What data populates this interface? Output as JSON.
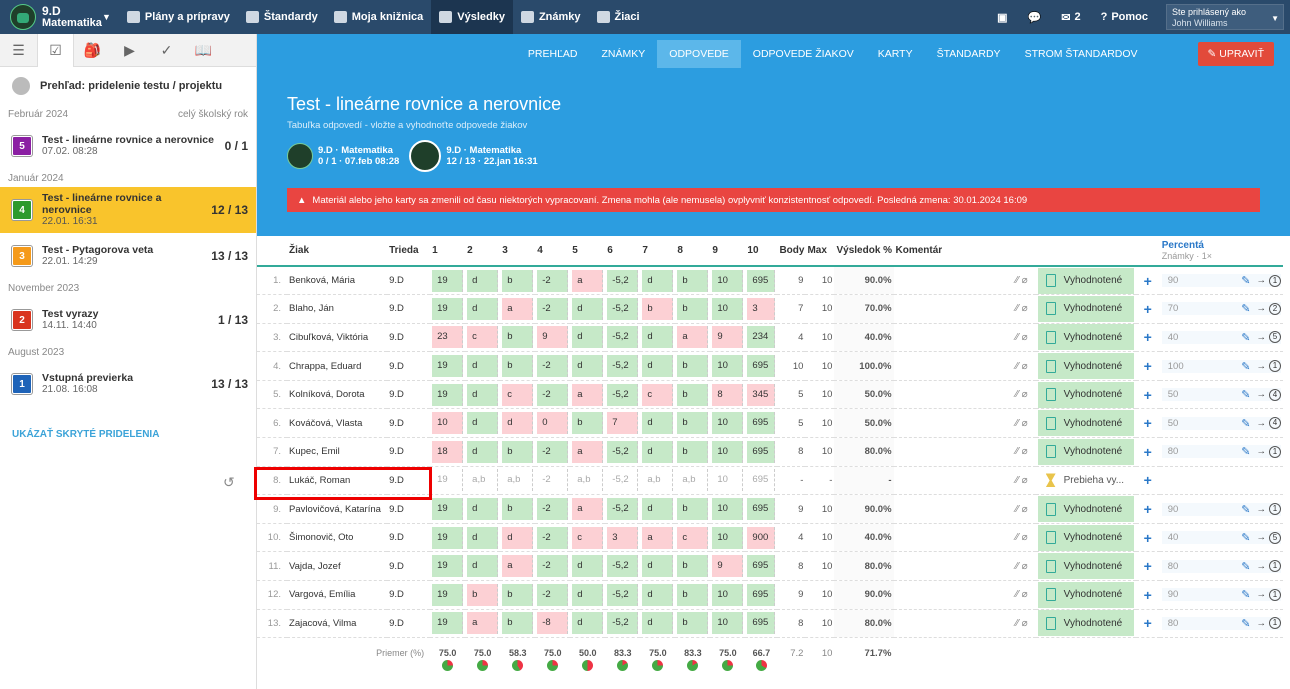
{
  "topbar": {
    "class_line1": "9.D",
    "class_line2": "Matematika",
    "nav": [
      "Plány a prípravy",
      "Štandardy",
      "Moja knižnica",
      "Výsledky",
      "Známky",
      "Žiaci"
    ],
    "active_nav": 3,
    "messages_count": "2",
    "help": "Pomoc",
    "user_label": "Ste prihlásený ako",
    "user_name": "John Williams"
  },
  "sidebar": {
    "overview": "Prehľad: pridelenie testu / projektu",
    "sections": [
      {
        "label": "Február 2024",
        "filter": "celý školský rok",
        "items": [
          {
            "badge": "5",
            "color": "#8b1fa3",
            "title": "Test - lineárne rovnice a nerovnice",
            "date": "07.02. 08:28",
            "score": "0 / 1"
          }
        ]
      },
      {
        "label": "Január 2024",
        "items": [
          {
            "badge": "4",
            "color": "#2d9a2d",
            "title": "Test - lineárne rovnice a nerovnice",
            "date": "22.01. 16:31",
            "score": "12 / 13",
            "selected": true
          },
          {
            "badge": "3",
            "color": "#f59a1a",
            "title": "Test - Pytagorova veta",
            "date": "22.01. 14:29",
            "score": "13 / 13"
          }
        ]
      },
      {
        "label": "November 2023",
        "items": [
          {
            "badge": "2",
            "color": "#d9341e",
            "title": "Test vyrazy",
            "date": "14.11. 14:40",
            "score": "1 / 13"
          }
        ]
      },
      {
        "label": "August 2023",
        "items": [
          {
            "badge": "1",
            "color": "#1e63b8",
            "title": "Vstupná previerka",
            "date": "21.08. 16:08",
            "score": "13 / 13"
          }
        ]
      }
    ],
    "show_hidden": "UKÁZAŤ SKRYTÉ PRIDELENIA"
  },
  "subnav": {
    "tabs": [
      "PREHĽAD",
      "ZNÁMKY",
      "ODPOVEDE",
      "ODPOVEDE ŽIAKOV",
      "KARTY",
      "ŠTANDARDY",
      "STROM ŠTANDARDOV"
    ],
    "active": 2,
    "edit": "UPRAVIŤ"
  },
  "hero": {
    "title": "Test - lineárne rovnice a nerovnice",
    "subtitle": "Tabuľka odpovedí - vložte a vyhodnoťte odpovede žiakov",
    "groups": [
      {
        "name": "9.D · Matematika",
        "info": "0 / 1 · 07.feb 08:28"
      },
      {
        "name": "9.D · Matematika",
        "info": "12 / 13 · 22.jan 16:31"
      }
    ],
    "alert": "Materiál alebo jeho karty sa zmenili od času niektorých vypracovaní. Zmena mohla (ale nemusela) ovplyvniť konzistentnosť odpovedí. Posledná zmena: 30.01.2024 16:09"
  },
  "table": {
    "headers": {
      "student": "Žiak",
      "class": "Trieda",
      "q": [
        "1",
        "2",
        "3",
        "4",
        "5",
        "6",
        "7",
        "8",
        "9",
        "10"
      ],
      "points": "Body",
      "max": "Max",
      "result": "Výsledok %",
      "comment": "Komentár",
      "percent": "Percentá",
      "grades": "Známky · 1×"
    },
    "rows": [
      {
        "n": "1.",
        "name": "Benková, Mária",
        "cls": "9.D",
        "a": [
          "19",
          "d",
          "b",
          "-2",
          "a",
          "-5,2",
          "d",
          "b",
          "10",
          "695"
        ],
        "ok": [
          1,
          1,
          1,
          1,
          0,
          1,
          1,
          1,
          1,
          1
        ],
        "pts": "9",
        "max": "10",
        "pct": "90.0%",
        "status": "Vyhodnotené",
        "gv": "90",
        "grade": "1"
      },
      {
        "n": "2.",
        "name": "Blaho, Ján",
        "cls": "9.D",
        "a": [
          "19",
          "d",
          "a",
          "-2",
          "d",
          "-5,2",
          "b",
          "b",
          "10",
          "3"
        ],
        "ok": [
          1,
          1,
          0,
          1,
          1,
          1,
          0,
          1,
          1,
          0
        ],
        "pts": "7",
        "max": "10",
        "pct": "70.0%",
        "status": "Vyhodnotené",
        "gv": "70",
        "grade": "2"
      },
      {
        "n": "3.",
        "name": "Cibuľková, Viktória",
        "cls": "9.D",
        "a": [
          "23",
          "c",
          "b",
          "9",
          "d",
          "-5,2",
          "d",
          "a",
          "9",
          "234"
        ],
        "ok": [
          0,
          0,
          1,
          0,
          1,
          1,
          1,
          0,
          0,
          1
        ],
        "pts": "4",
        "max": "10",
        "pct": "40.0%",
        "status": "Vyhodnotené",
        "gv": "40",
        "grade": "5"
      },
      {
        "n": "4.",
        "name": "Chrappa, Eduard",
        "cls": "9.D",
        "a": [
          "19",
          "d",
          "b",
          "-2",
          "d",
          "-5,2",
          "d",
          "b",
          "10",
          "695"
        ],
        "ok": [
          1,
          1,
          1,
          1,
          1,
          1,
          1,
          1,
          1,
          1
        ],
        "pts": "10",
        "max": "10",
        "pct": "100.0%",
        "status": "Vyhodnotené",
        "gv": "100",
        "grade": "1"
      },
      {
        "n": "5.",
        "name": "Kolníková, Dorota",
        "cls": "9.D",
        "a": [
          "19",
          "d",
          "c",
          "-2",
          "a",
          "-5,2",
          "c",
          "b",
          "8",
          "345"
        ],
        "ok": [
          1,
          1,
          0,
          1,
          0,
          1,
          0,
          1,
          0,
          0
        ],
        "pts": "5",
        "max": "10",
        "pct": "50.0%",
        "status": "Vyhodnotené",
        "gv": "50",
        "grade": "4"
      },
      {
        "n": "6.",
        "name": "Kováčová, Vlasta",
        "cls": "9.D",
        "a": [
          "10",
          "d",
          "d",
          "0",
          "b",
          "7",
          "d",
          "b",
          "10",
          "695"
        ],
        "ok": [
          0,
          1,
          0,
          0,
          1,
          0,
          1,
          1,
          1,
          1
        ],
        "pts": "5",
        "max": "10",
        "pct": "50.0%",
        "status": "Vyhodnotené",
        "gv": "50",
        "grade": "4"
      },
      {
        "n": "7.",
        "name": "Kupec, Emil",
        "cls": "9.D",
        "a": [
          "18",
          "d",
          "b",
          "-2",
          "a",
          "-5,2",
          "d",
          "b",
          "10",
          "695"
        ],
        "ok": [
          0,
          1,
          1,
          1,
          0,
          1,
          1,
          1,
          1,
          1
        ],
        "pts": "8",
        "max": "10",
        "pct": "80.0%",
        "status": "Vyhodnotené",
        "gv": "80",
        "grade": "1"
      },
      {
        "n": "8.",
        "name": "Lukáč, Roman",
        "cls": "9.D",
        "a": [
          "19",
          "a,b",
          "a,b",
          "-2",
          "a,b",
          "-5,2",
          "a,b",
          "a,b",
          "10",
          "695"
        ],
        "ok": [
          2,
          2,
          2,
          2,
          2,
          2,
          2,
          2,
          2,
          2
        ],
        "pts": "-",
        "max": "-",
        "pct": "-",
        "status": "Prebieha vy...",
        "pending": true,
        "gv": "",
        "grade": ""
      },
      {
        "n": "9.",
        "name": "Pavlovičová, Katarína",
        "cls": "9.D",
        "a": [
          "19",
          "d",
          "b",
          "-2",
          "a",
          "-5,2",
          "d",
          "b",
          "10",
          "695"
        ],
        "ok": [
          1,
          1,
          1,
          1,
          0,
          1,
          1,
          1,
          1,
          1
        ],
        "pts": "9",
        "max": "10",
        "pct": "90.0%",
        "status": "Vyhodnotené",
        "gv": "90",
        "grade": "1"
      },
      {
        "n": "10.",
        "name": "Šimonovič, Oto",
        "cls": "9.D",
        "a": [
          "19",
          "d",
          "d",
          "-2",
          "c",
          "3",
          "a",
          "c",
          "10",
          "900"
        ],
        "ok": [
          1,
          1,
          0,
          1,
          0,
          0,
          0,
          0,
          1,
          0
        ],
        "pts": "4",
        "max": "10",
        "pct": "40.0%",
        "status": "Vyhodnotené",
        "gv": "40",
        "grade": "5"
      },
      {
        "n": "11.",
        "name": "Vajda, Jozef",
        "cls": "9.D",
        "a": [
          "19",
          "d",
          "a",
          "-2",
          "d",
          "-5,2",
          "d",
          "b",
          "9",
          "695"
        ],
        "ok": [
          1,
          1,
          0,
          1,
          1,
          1,
          1,
          1,
          0,
          1
        ],
        "pts": "8",
        "max": "10",
        "pct": "80.0%",
        "status": "Vyhodnotené",
        "gv": "80",
        "grade": "1"
      },
      {
        "n": "12.",
        "name": "Vargová, Emília",
        "cls": "9.D",
        "a": [
          "19",
          "b",
          "b",
          "-2",
          "d",
          "-5,2",
          "d",
          "b",
          "10",
          "695"
        ],
        "ok": [
          1,
          0,
          1,
          1,
          1,
          1,
          1,
          1,
          1,
          1
        ],
        "pts": "9",
        "max": "10",
        "pct": "90.0%",
        "status": "Vyhodnotené",
        "gv": "90",
        "grade": "1"
      },
      {
        "n": "13.",
        "name": "Zajacová, Vilma",
        "cls": "9.D",
        "a": [
          "19",
          "a",
          "b",
          "-8",
          "d",
          "-5,2",
          "d",
          "b",
          "10",
          "695"
        ],
        "ok": [
          1,
          0,
          1,
          0,
          1,
          1,
          1,
          1,
          1,
          1
        ],
        "pts": "8",
        "max": "10",
        "pct": "80.0%",
        "status": "Vyhodnotené",
        "gv": "80",
        "grade": "1"
      }
    ],
    "avg_label": "Priemer (%)",
    "avg": [
      "75.0",
      "75.0",
      "58.3",
      "75.0",
      "50.0",
      "83.3",
      "75.0",
      "83.3",
      "75.0",
      "66.7"
    ],
    "avg_pts": "7.2",
    "avg_max": "10",
    "avg_pct": "71.7%"
  },
  "colors": {
    "correct": "#c6e9c8",
    "wrong": "#fcd0d4",
    "accent": "#2c9de0",
    "alert": "#e94541"
  }
}
